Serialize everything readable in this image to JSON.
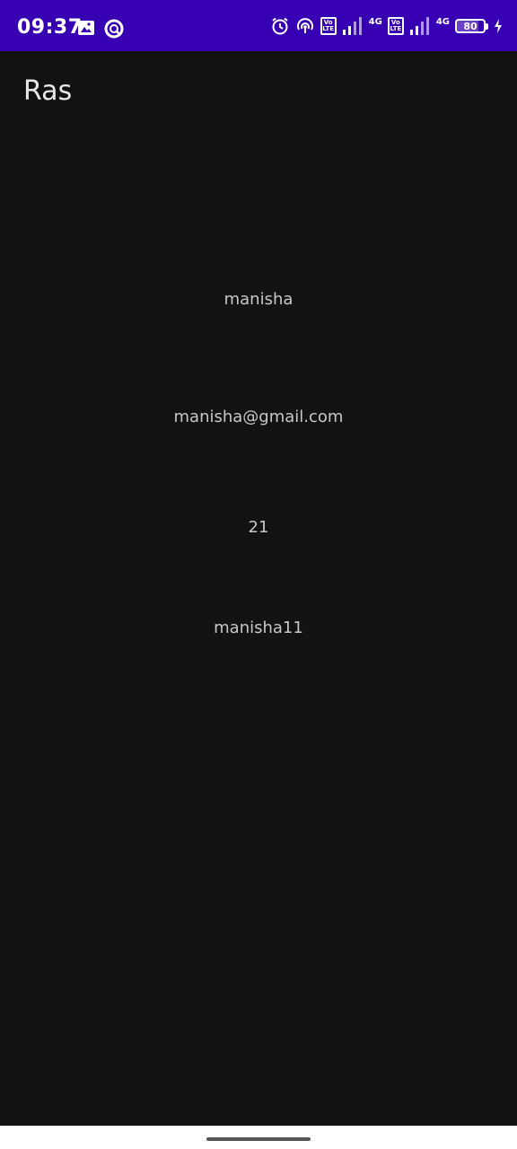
{
  "status_bar": {
    "time": "09:37",
    "left_icons": [
      "image-icon",
      "data-saver-icon"
    ],
    "right_icons": [
      "alarm-icon",
      "hotspot-icon",
      "volte-icon",
      "signal-icon",
      "volte-icon",
      "signal-icon"
    ],
    "volte_top": "Vo",
    "volte_bottom": "LTE",
    "network_1": "4G",
    "network_2": "4G",
    "battery_level": "80",
    "charging": true,
    "background_color": "#3700b3"
  },
  "app_bar": {
    "title": "Ras"
  },
  "profile": {
    "name": "manisha",
    "email": "manisha@gmail.com",
    "age": "21",
    "username": "manisha11"
  },
  "theme": {
    "background": "#121212",
    "text": "#c8c8c8"
  }
}
